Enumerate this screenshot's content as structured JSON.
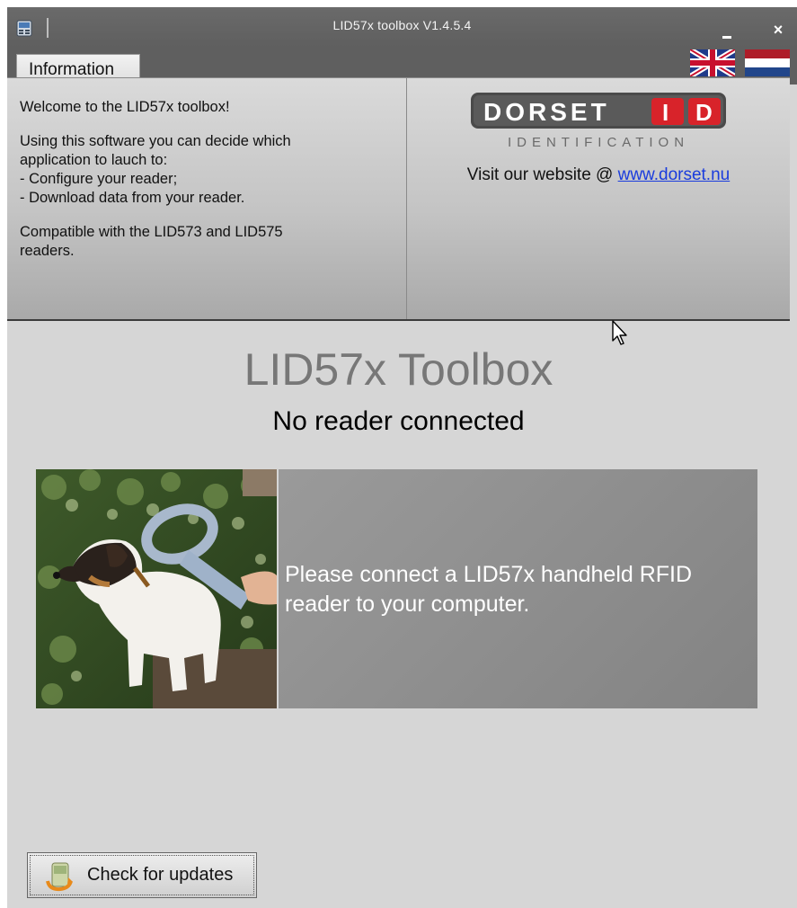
{
  "window": {
    "title": "LID57x toolbox V1.4.5.4",
    "close_glyph": "×"
  },
  "tabs": [
    {
      "label": "Information"
    }
  ],
  "flags": {
    "english": "uk-flag-icon",
    "dutch": "nl-flag-icon"
  },
  "info": {
    "welcome": "Welcome to the LID57x toolbox!",
    "intro_line1": "Using this software you can decide which",
    "intro_line2": "application to lauch to:",
    "option1": "- Configure your reader;",
    "option2": "- Download data from your reader.",
    "compat_line1": "Compatible with the LID573 and LID575",
    "compat_line2": "readers.",
    "logo_word": "DORSET",
    "logo_id": "ID",
    "logo_sub": "IDENTIFICATION",
    "visit_text": "Visit our website @ ",
    "website_link": "www.dorset.nu"
  },
  "main": {
    "title": "LID57x Toolbox",
    "status": "No reader connected",
    "message_line1": "Please connect a LID57x handheld RFID",
    "message_line2": "reader to your computer."
  },
  "update_button": {
    "label": "Check for updates"
  },
  "colors": {
    "titlebar": "#5f5f5f",
    "link": "#1a3cdd",
    "logo_red": "#d8232a",
    "main_title": "#777777"
  }
}
